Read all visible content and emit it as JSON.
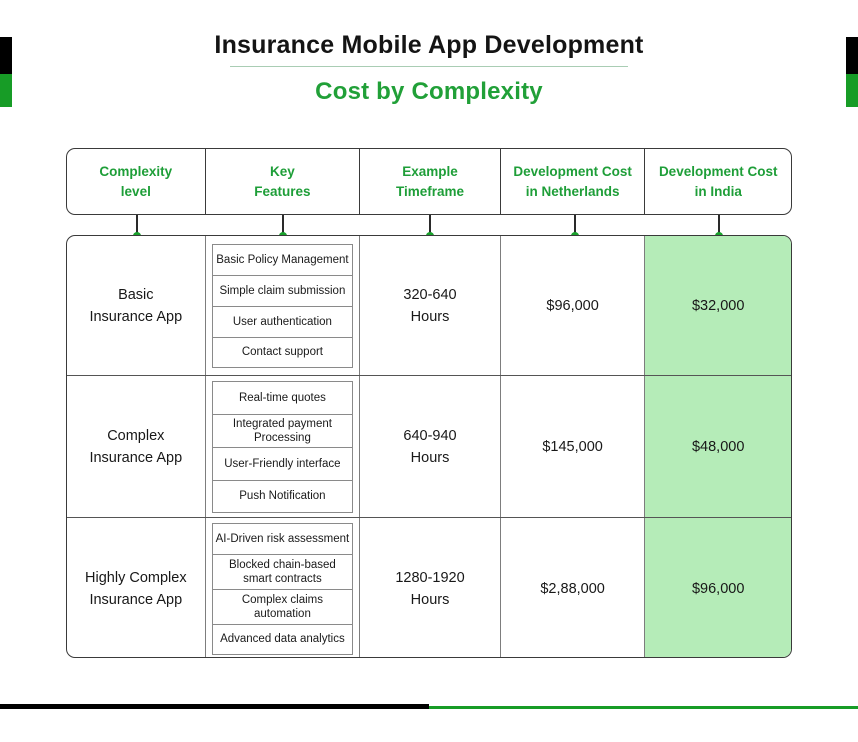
{
  "title": {
    "main": "Insurance Mobile App Development",
    "subtitle": "Cost by Complexity"
  },
  "colors": {
    "accent_green": "#21a038",
    "header_text_green": "#1e9e38",
    "highlight_fill": "#b5ecb8",
    "rule_black": "#000000",
    "rule_green": "#179c26",
    "body_text": "#181818"
  },
  "table": {
    "headers": [
      {
        "line1": "Complexity",
        "line2": "level"
      },
      {
        "line1": "Key",
        "line2": "Features"
      },
      {
        "line1": "Example",
        "line2": "Timeframe"
      },
      {
        "line1": "Development Cost",
        "line2": "in Netherlands"
      },
      {
        "line1": "Development Cost",
        "line2": "in India"
      }
    ],
    "rows": [
      {
        "complexity_line1": "Basic",
        "complexity_line2": "Insurance App",
        "features": [
          "Basic Policy Management",
          "Simple claim submission",
          "User authentication",
          "Contact support"
        ],
        "timeframe_line1": "320-640",
        "timeframe_line2": "Hours",
        "cost_netherlands": "$96,000",
        "cost_india": "$32,000"
      },
      {
        "complexity_line1": "Complex",
        "complexity_line2": "Insurance App",
        "features": [
          "Real-time quotes",
          "Integrated payment Processing",
          "User-Friendly interface",
          "Push Notification"
        ],
        "timeframe_line1": "640-940",
        "timeframe_line2": "Hours",
        "cost_netherlands": "$145,000",
        "cost_india": "$48,000"
      },
      {
        "complexity_line1": "Highly Complex",
        "complexity_line2": "Insurance App",
        "features": [
          "AI-Driven risk assessment",
          "Blocked chain-based smart contracts",
          "Complex claims automation",
          "Advanced data analytics"
        ],
        "timeframe_line1": "1280-1920",
        "timeframe_line2": "Hours",
        "cost_netherlands": "$2,88,000",
        "cost_india": "$96,000"
      }
    ]
  }
}
